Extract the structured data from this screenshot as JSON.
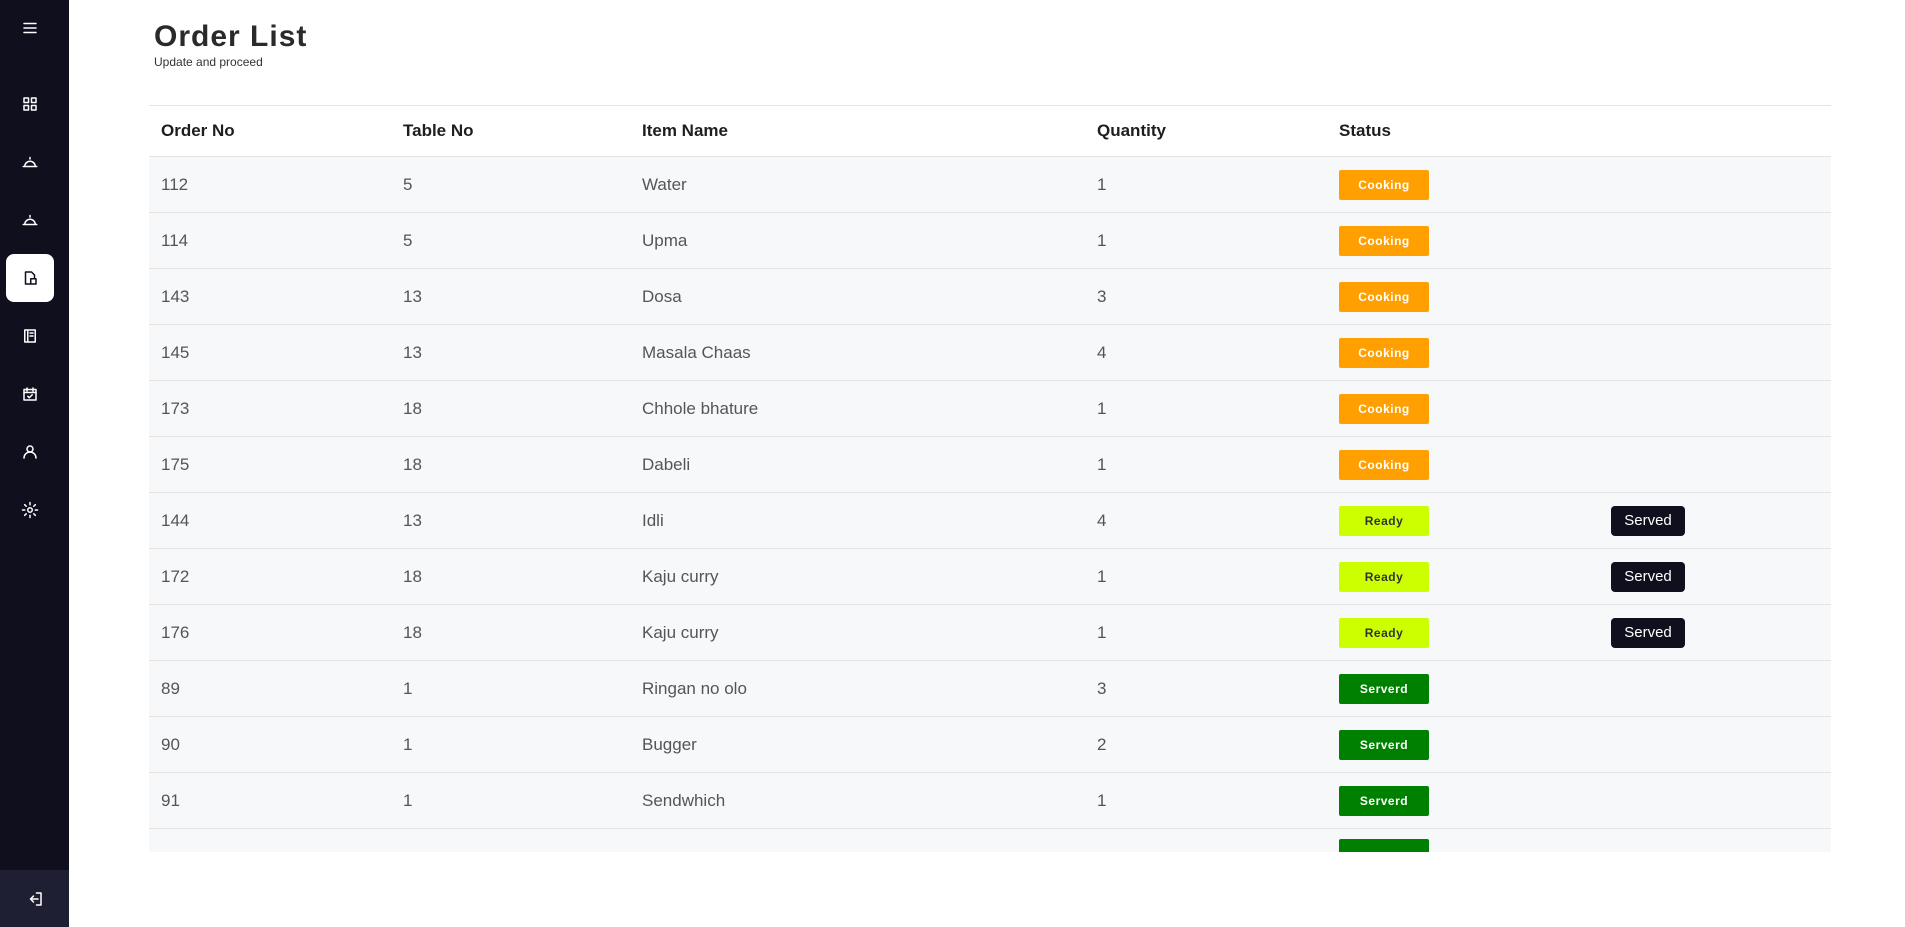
{
  "header": {
    "title": "Order List",
    "subtitle": "Update and proceed"
  },
  "table": {
    "columns": [
      "Order No",
      "Table No",
      "Item Name",
      "Quantity",
      "Status"
    ],
    "served_button_label": "Served",
    "rows": [
      {
        "order_no": "112",
        "table_no": "5",
        "item": "Water",
        "quantity": "1",
        "status": "Cooking",
        "status_type": "cooking",
        "action": ""
      },
      {
        "order_no": "114",
        "table_no": "5",
        "item": "Upma",
        "quantity": "1",
        "status": "Cooking",
        "status_type": "cooking",
        "action": ""
      },
      {
        "order_no": "143",
        "table_no": "13",
        "item": "Dosa",
        "quantity": "3",
        "status": "Cooking",
        "status_type": "cooking",
        "action": ""
      },
      {
        "order_no": "145",
        "table_no": "13",
        "item": "Masala Chaas",
        "quantity": "4",
        "status": "Cooking",
        "status_type": "cooking",
        "action": ""
      },
      {
        "order_no": "173",
        "table_no": "18",
        "item": "Chhole bhature",
        "quantity": "1",
        "status": "Cooking",
        "status_type": "cooking",
        "action": ""
      },
      {
        "order_no": "175",
        "table_no": "18",
        "item": "Dabeli",
        "quantity": "1",
        "status": "Cooking",
        "status_type": "cooking",
        "action": ""
      },
      {
        "order_no": "144",
        "table_no": "13",
        "item": "Idli",
        "quantity": "4",
        "status": "Ready",
        "status_type": "ready",
        "action": "Served"
      },
      {
        "order_no": "172",
        "table_no": "18",
        "item": "Kaju curry",
        "quantity": "1",
        "status": "Ready",
        "status_type": "ready",
        "action": "Served"
      },
      {
        "order_no": "176",
        "table_no": "18",
        "item": "Kaju curry",
        "quantity": "1",
        "status": "Ready",
        "status_type": "ready",
        "action": "Served"
      },
      {
        "order_no": "89",
        "table_no": "1",
        "item": "Ringan no olo",
        "quantity": "3",
        "status": "Serverd",
        "status_type": "served",
        "action": ""
      },
      {
        "order_no": "90",
        "table_no": "1",
        "item": "Bugger",
        "quantity": "2",
        "status": "Serverd",
        "status_type": "served",
        "action": ""
      },
      {
        "order_no": "91",
        "table_no": "1",
        "item": "Sendwhich",
        "quantity": "1",
        "status": "Serverd",
        "status_type": "served",
        "action": ""
      },
      {
        "order_no": "",
        "table_no": "",
        "item": "",
        "quantity": "",
        "status": "",
        "status_type": "served",
        "action": ""
      }
    ]
  },
  "sidebar": {
    "items": [
      {
        "icon": "menu-icon"
      },
      {
        "icon": "dashboard-icon"
      },
      {
        "icon": "cloche-icon"
      },
      {
        "icon": "cloche-icon"
      },
      {
        "icon": "orders-icon",
        "active": true
      },
      {
        "icon": "book-icon"
      },
      {
        "icon": "calendar-icon"
      },
      {
        "icon": "user-icon"
      },
      {
        "icon": "gear-icon"
      },
      {
        "icon": "logout-icon"
      }
    ]
  },
  "colors": {
    "sidebar": "#0f0f1e",
    "cooking": "#ffa000",
    "ready": "#ccff00",
    "served": "#008000"
  }
}
